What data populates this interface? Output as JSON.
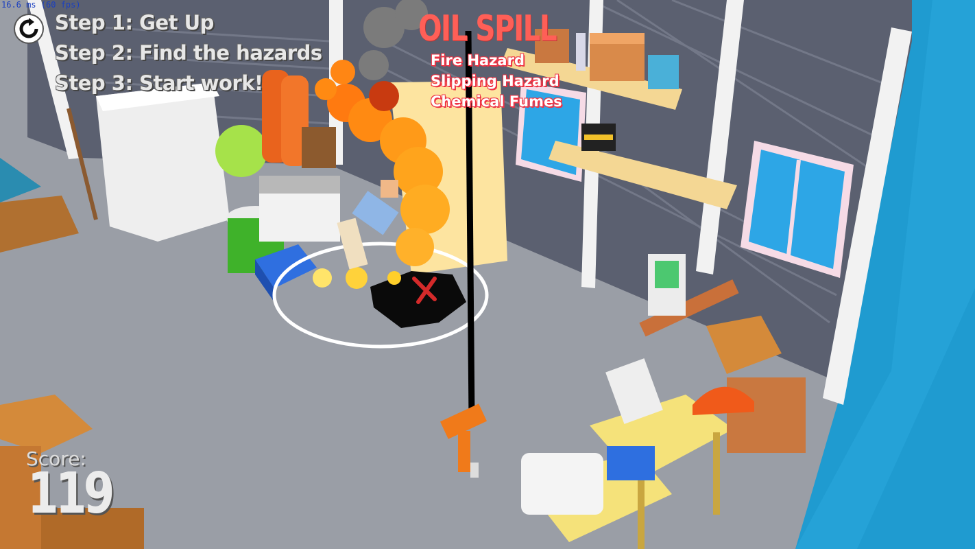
{
  "perf": {
    "text": "16.6 ms (60 fps)"
  },
  "hud": {
    "steps": [
      "Step 1: Get Up",
      "Step 2: Find the hazards",
      "Step 3: Start work!"
    ],
    "restart_icon": "restart-icon"
  },
  "hazard": {
    "title": "OIL SPILL",
    "items": [
      "Fire Hazard",
      "Slipping Hazard",
      "Chemical Fumes"
    ],
    "title_color": "#ff5f57"
  },
  "score": {
    "label": "Score:",
    "value": "119"
  },
  "colors": {
    "floor": "#9a9ea6",
    "wall": "#5a5f6e",
    "backdrop": "#1f9bd0",
    "fire": "#ff8a12",
    "oil": "#0a0a0a"
  }
}
